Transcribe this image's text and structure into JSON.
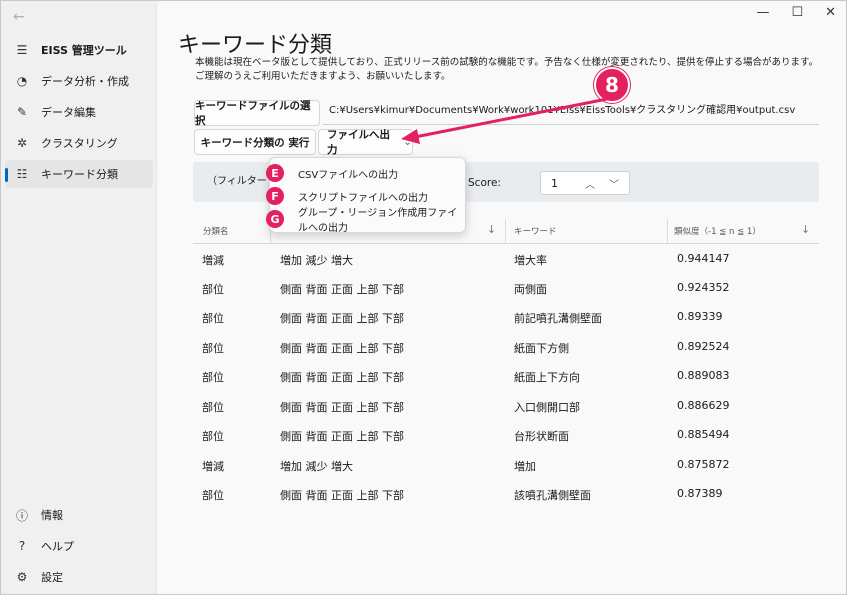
{
  "sidebar": {
    "back_icon": "back-arrow-icon",
    "app_title": "EISS 管理ツール",
    "items": [
      {
        "label": "データ分析・作成",
        "icon": "chart-icon"
      },
      {
        "label": "データ編集",
        "icon": "pencil-icon"
      },
      {
        "label": "クラスタリング",
        "icon": "cluster-icon"
      },
      {
        "label": "キーワード分類",
        "icon": "list-icon",
        "selected": true
      }
    ],
    "bottom_items": [
      {
        "label": "情報",
        "icon": "info-icon"
      },
      {
        "label": "ヘルプ",
        "icon": "help-icon"
      },
      {
        "label": "設定",
        "icon": "gear-icon"
      }
    ]
  },
  "window": {
    "minimize": "—",
    "maximize": "☐",
    "close": "✕"
  },
  "main": {
    "title": "キーワード分類",
    "description_line1": "本機能は現在ベータ版として提供しており、正式リリース前の試験的な機能です。予告なく仕様が変更されたり、提供を停止する場合があります。",
    "description_line2": "ご理解のうえご利用いただきますよう、お願いいたします。",
    "select_file_button": "キーワードファイルの選択",
    "file_path": "C:¥Users¥kimur¥Documents¥Work¥work101¥Eiss¥EissTools¥クラスタリング確認用¥output.csv",
    "run_button": "キーワード分類の 実行",
    "export_button": "ファイルへ出力",
    "export_chevron": "⌄",
    "filter_label": "（フィルター",
    "score_label": "Score:",
    "score_value": "1"
  },
  "dropdown": {
    "items": [
      {
        "badge": "E",
        "label": "CSVファイルへの出力"
      },
      {
        "badge": "F",
        "label": "スクリプトファイルへの出力"
      },
      {
        "badge": "G",
        "label": "グループ・リージョン作成用ファイルへの出力"
      }
    ]
  },
  "annotation": {
    "step": "8",
    "color": "#e4205e"
  },
  "table": {
    "headers": [
      "分類名",
      "",
      "キーワード",
      "類似度（-1 ≦ n ≦ 1）"
    ],
    "rows": [
      [
        "増減",
        "増加 減少 増大",
        "増大率",
        "0.944147"
      ],
      [
        "部位",
        "側面 背面 正面 上部 下部",
        "両側面",
        "0.924352"
      ],
      [
        "部位",
        "側面 背面 正面 上部 下部",
        "前記噴孔溝側壁面",
        "0.89339"
      ],
      [
        "部位",
        "側面 背面 正面 上部 下部",
        "紙面下方側",
        "0.892524"
      ],
      [
        "部位",
        "側面 背面 正面 上部 下部",
        "紙面上下方向",
        "0.889083"
      ],
      [
        "部位",
        "側面 背面 正面 上部 下部",
        "入口側開口部",
        "0.886629"
      ],
      [
        "部位",
        "側面 背面 正面 上部 下部",
        "台形状断面",
        "0.885494"
      ],
      [
        "増減",
        "増加 減少 増大",
        "増加",
        "0.875872"
      ],
      [
        "部位",
        "側面 背面 正面 上部 下部",
        "該噴孔溝側壁面",
        "0.87389"
      ]
    ]
  }
}
